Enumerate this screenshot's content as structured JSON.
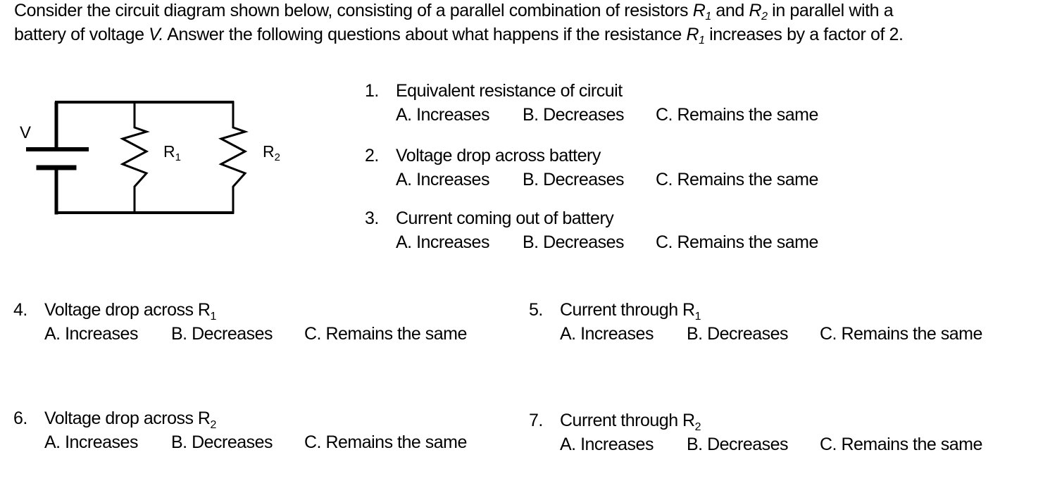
{
  "intro": {
    "line1_a": "Consider the circuit diagram shown below, consisting of a parallel combination of resistors ",
    "r": "R",
    "sub1": "1",
    "and": " and ",
    "sub2": "2",
    "line1_b": " in parallel with a",
    "line2_a": "battery  of voltage ",
    "v": "V.",
    "line2_b": " Answer the following questions about what happens if  the resistance ",
    "line2_c": " increases by a factor of 2."
  },
  "circuit": {
    "battery_label": "V",
    "r1_label": "R",
    "r1_sub": "1",
    "r2_label": "R",
    "r2_sub": "2"
  },
  "questions": [
    {
      "num": "1.",
      "title": "Equivalent resistance of circuit",
      "sub": "",
      "options": [
        "A. Increases",
        "B. Decreases",
        "C. Remains the same"
      ]
    },
    {
      "num": "2.",
      "title": "Voltage drop across battery",
      "sub": "",
      "options": [
        "A. Increases",
        "B. Decreases",
        "C. Remains the same"
      ]
    },
    {
      "num": "3.",
      "title": "Current coming out of battery",
      "sub": "",
      "options": [
        "A. Increases",
        "B. Decreases",
        "C. Remains the same"
      ]
    },
    {
      "num": "4.",
      "title": "Voltage drop across R",
      "sub": "1",
      "options": [
        "A. Increases",
        "B. Decreases",
        "C. Remains the same"
      ]
    },
    {
      "num": "5.",
      "title": "Current through R",
      "sub": "1",
      "options": [
        "A. Increases",
        "B. Decreases",
        "C. Remains the same"
      ]
    },
    {
      "num": "6.",
      "title": "Voltage drop across R",
      "sub": "2",
      "options": [
        "A. Increases",
        "B. Decreases",
        "C. Remains the same"
      ]
    },
    {
      "num": "7.",
      "title": "Current through R",
      "sub": "2",
      "options": [
        "A. Increases",
        "B. Decreases",
        "C. Remains the same"
      ]
    }
  ]
}
